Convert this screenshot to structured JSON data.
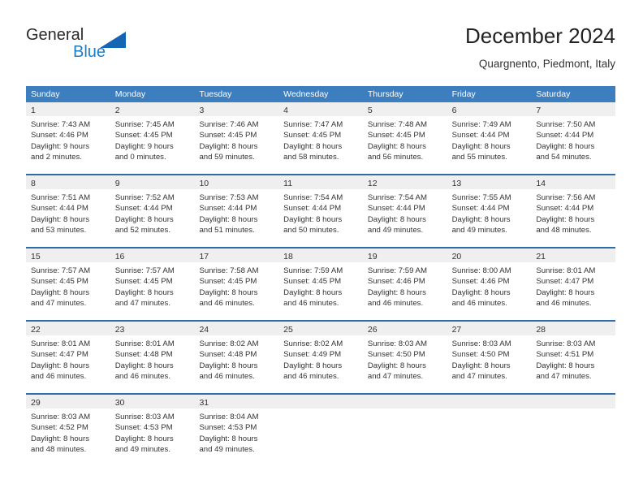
{
  "brand": {
    "name_part1": "General",
    "name_part2": "Blue",
    "triangle_color": "#1565b5",
    "blue_color": "#1a7ec8"
  },
  "header": {
    "title": "December 2024",
    "subtitle": "Quargnento, Piedmont, Italy"
  },
  "theme": {
    "header_blue": "#3d7ebf",
    "row_border_blue": "#2f6cac",
    "daynum_band": "#efefef",
    "text": "#333333"
  },
  "weekdays": [
    "Sunday",
    "Monday",
    "Tuesday",
    "Wednesday",
    "Thursday",
    "Friday",
    "Saturday"
  ],
  "weeks": [
    [
      {
        "day": "1",
        "sunrise": "Sunrise: 7:43 AM",
        "sunset": "Sunset: 4:46 PM",
        "daylight1": "Daylight: 9 hours",
        "daylight2": "and 2 minutes."
      },
      {
        "day": "2",
        "sunrise": "Sunrise: 7:45 AM",
        "sunset": "Sunset: 4:45 PM",
        "daylight1": "Daylight: 9 hours",
        "daylight2": "and 0 minutes."
      },
      {
        "day": "3",
        "sunrise": "Sunrise: 7:46 AM",
        "sunset": "Sunset: 4:45 PM",
        "daylight1": "Daylight: 8 hours",
        "daylight2": "and 59 minutes."
      },
      {
        "day": "4",
        "sunrise": "Sunrise: 7:47 AM",
        "sunset": "Sunset: 4:45 PM",
        "daylight1": "Daylight: 8 hours",
        "daylight2": "and 58 minutes."
      },
      {
        "day": "5",
        "sunrise": "Sunrise: 7:48 AM",
        "sunset": "Sunset: 4:45 PM",
        "daylight1": "Daylight: 8 hours",
        "daylight2": "and 56 minutes."
      },
      {
        "day": "6",
        "sunrise": "Sunrise: 7:49 AM",
        "sunset": "Sunset: 4:44 PM",
        "daylight1": "Daylight: 8 hours",
        "daylight2": "and 55 minutes."
      },
      {
        "day": "7",
        "sunrise": "Sunrise: 7:50 AM",
        "sunset": "Sunset: 4:44 PM",
        "daylight1": "Daylight: 8 hours",
        "daylight2": "and 54 minutes."
      }
    ],
    [
      {
        "day": "8",
        "sunrise": "Sunrise: 7:51 AM",
        "sunset": "Sunset: 4:44 PM",
        "daylight1": "Daylight: 8 hours",
        "daylight2": "and 53 minutes."
      },
      {
        "day": "9",
        "sunrise": "Sunrise: 7:52 AM",
        "sunset": "Sunset: 4:44 PM",
        "daylight1": "Daylight: 8 hours",
        "daylight2": "and 52 minutes."
      },
      {
        "day": "10",
        "sunrise": "Sunrise: 7:53 AM",
        "sunset": "Sunset: 4:44 PM",
        "daylight1": "Daylight: 8 hours",
        "daylight2": "and 51 minutes."
      },
      {
        "day": "11",
        "sunrise": "Sunrise: 7:54 AM",
        "sunset": "Sunset: 4:44 PM",
        "daylight1": "Daylight: 8 hours",
        "daylight2": "and 50 minutes."
      },
      {
        "day": "12",
        "sunrise": "Sunrise: 7:54 AM",
        "sunset": "Sunset: 4:44 PM",
        "daylight1": "Daylight: 8 hours",
        "daylight2": "and 49 minutes."
      },
      {
        "day": "13",
        "sunrise": "Sunrise: 7:55 AM",
        "sunset": "Sunset: 4:44 PM",
        "daylight1": "Daylight: 8 hours",
        "daylight2": "and 49 minutes."
      },
      {
        "day": "14",
        "sunrise": "Sunrise: 7:56 AM",
        "sunset": "Sunset: 4:44 PM",
        "daylight1": "Daylight: 8 hours",
        "daylight2": "and 48 minutes."
      }
    ],
    [
      {
        "day": "15",
        "sunrise": "Sunrise: 7:57 AM",
        "sunset": "Sunset: 4:45 PM",
        "daylight1": "Daylight: 8 hours",
        "daylight2": "and 47 minutes."
      },
      {
        "day": "16",
        "sunrise": "Sunrise: 7:57 AM",
        "sunset": "Sunset: 4:45 PM",
        "daylight1": "Daylight: 8 hours",
        "daylight2": "and 47 minutes."
      },
      {
        "day": "17",
        "sunrise": "Sunrise: 7:58 AM",
        "sunset": "Sunset: 4:45 PM",
        "daylight1": "Daylight: 8 hours",
        "daylight2": "and 46 minutes."
      },
      {
        "day": "18",
        "sunrise": "Sunrise: 7:59 AM",
        "sunset": "Sunset: 4:45 PM",
        "daylight1": "Daylight: 8 hours",
        "daylight2": "and 46 minutes."
      },
      {
        "day": "19",
        "sunrise": "Sunrise: 7:59 AM",
        "sunset": "Sunset: 4:46 PM",
        "daylight1": "Daylight: 8 hours",
        "daylight2": "and 46 minutes."
      },
      {
        "day": "20",
        "sunrise": "Sunrise: 8:00 AM",
        "sunset": "Sunset: 4:46 PM",
        "daylight1": "Daylight: 8 hours",
        "daylight2": "and 46 minutes."
      },
      {
        "day": "21",
        "sunrise": "Sunrise: 8:01 AM",
        "sunset": "Sunset: 4:47 PM",
        "daylight1": "Daylight: 8 hours",
        "daylight2": "and 46 minutes."
      }
    ],
    [
      {
        "day": "22",
        "sunrise": "Sunrise: 8:01 AM",
        "sunset": "Sunset: 4:47 PM",
        "daylight1": "Daylight: 8 hours",
        "daylight2": "and 46 minutes."
      },
      {
        "day": "23",
        "sunrise": "Sunrise: 8:01 AM",
        "sunset": "Sunset: 4:48 PM",
        "daylight1": "Daylight: 8 hours",
        "daylight2": "and 46 minutes."
      },
      {
        "day": "24",
        "sunrise": "Sunrise: 8:02 AM",
        "sunset": "Sunset: 4:48 PM",
        "daylight1": "Daylight: 8 hours",
        "daylight2": "and 46 minutes."
      },
      {
        "day": "25",
        "sunrise": "Sunrise: 8:02 AM",
        "sunset": "Sunset: 4:49 PM",
        "daylight1": "Daylight: 8 hours",
        "daylight2": "and 46 minutes."
      },
      {
        "day": "26",
        "sunrise": "Sunrise: 8:03 AM",
        "sunset": "Sunset: 4:50 PM",
        "daylight1": "Daylight: 8 hours",
        "daylight2": "and 47 minutes."
      },
      {
        "day": "27",
        "sunrise": "Sunrise: 8:03 AM",
        "sunset": "Sunset: 4:50 PM",
        "daylight1": "Daylight: 8 hours",
        "daylight2": "and 47 minutes."
      },
      {
        "day": "28",
        "sunrise": "Sunrise: 8:03 AM",
        "sunset": "Sunset: 4:51 PM",
        "daylight1": "Daylight: 8 hours",
        "daylight2": "and 47 minutes."
      }
    ],
    [
      {
        "day": "29",
        "sunrise": "Sunrise: 8:03 AM",
        "sunset": "Sunset: 4:52 PM",
        "daylight1": "Daylight: 8 hours",
        "daylight2": "and 48 minutes."
      },
      {
        "day": "30",
        "sunrise": "Sunrise: 8:03 AM",
        "sunset": "Sunset: 4:53 PM",
        "daylight1": "Daylight: 8 hours",
        "daylight2": "and 49 minutes."
      },
      {
        "day": "31",
        "sunrise": "Sunrise: 8:04 AM",
        "sunset": "Sunset: 4:53 PM",
        "daylight1": "Daylight: 8 hours",
        "daylight2": "and 49 minutes."
      },
      {
        "day": "",
        "sunrise": "",
        "sunset": "",
        "daylight1": "",
        "daylight2": ""
      },
      {
        "day": "",
        "sunrise": "",
        "sunset": "",
        "daylight1": "",
        "daylight2": ""
      },
      {
        "day": "",
        "sunrise": "",
        "sunset": "",
        "daylight1": "",
        "daylight2": ""
      },
      {
        "day": "",
        "sunrise": "",
        "sunset": "",
        "daylight1": "",
        "daylight2": ""
      }
    ]
  ]
}
